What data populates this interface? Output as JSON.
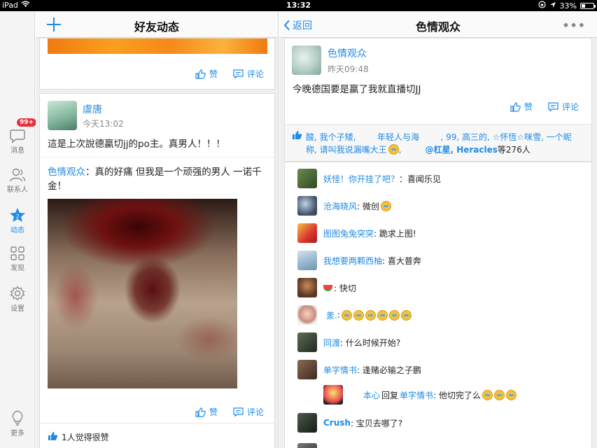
{
  "status_bar": {
    "device": "iPad",
    "time": "13:32",
    "battery": "33%",
    "battery_level": 0.33
  },
  "rail": {
    "badge": "99+",
    "items": [
      {
        "label": "消息"
      },
      {
        "label": "联系人"
      },
      {
        "label": "动态"
      },
      {
        "label": "发现"
      },
      {
        "label": "设置"
      },
      {
        "label": "更多"
      }
    ]
  },
  "left_panel": {
    "title": "好友动态",
    "top_card": {
      "like": "赞",
      "comment": "评论"
    },
    "post": {
      "author": "虞唐",
      "time": "今天13:02",
      "text": "這是上次說德贏切jj的po主。真男人！！！",
      "forward_author": "色情观众",
      "forward_text": "：真的好痛 但我是一个顽强的男人 一诺千金！",
      "like": "赞",
      "comment": "评论",
      "likes_summary": "1人觉得很赞"
    }
  },
  "right_panel": {
    "back": "返回",
    "title": "色情观众",
    "more": "•••",
    "post": {
      "author": "色情观众",
      "time": "昨天09:48",
      "text": "今晚德国要是赢了我就直播切JJ",
      "like": "赞",
      "comment": "评论"
    },
    "likes": {
      "line1_names": "酸, 我个子矮,        年轻人与海        , 99, 高三的, ☆怀恆☆咪雪, 一个昵",
      "line2_names": "称, 请叫我说漏嘴大王",
      "line2_mid": ",",
      "line2_tail": "@杠星, Heracles",
      "count": "等276人"
    },
    "comments": [
      {
        "name": "妖怪！你开挂了吧？",
        "text": "：喜闻乐见"
      },
      {
        "name": "沧海晓风",
        "text": ": 微创"
      },
      {
        "name": "图图兔兔突突",
        "text": ": 跪求上图!"
      },
      {
        "name": "我想要两颗西柚",
        "text": ": 喜大普奔"
      },
      {
        "name": "",
        "text": ": 快切"
      },
      {
        "name": "羕.",
        "text": ":"
      },
      {
        "name": "同渡",
        "text": ": 什么时候开始?"
      },
      {
        "name": "单字情书",
        "text": ": 逢赌必输之子鹏"
      },
      {
        "name": "本心",
        "reply_word": "回复",
        "reply_to": "单字情书",
        "text": ": 他切完了么"
      },
      {
        "name": "Crush",
        "text": ": 宝贝去哪了?"
      }
    ]
  }
}
